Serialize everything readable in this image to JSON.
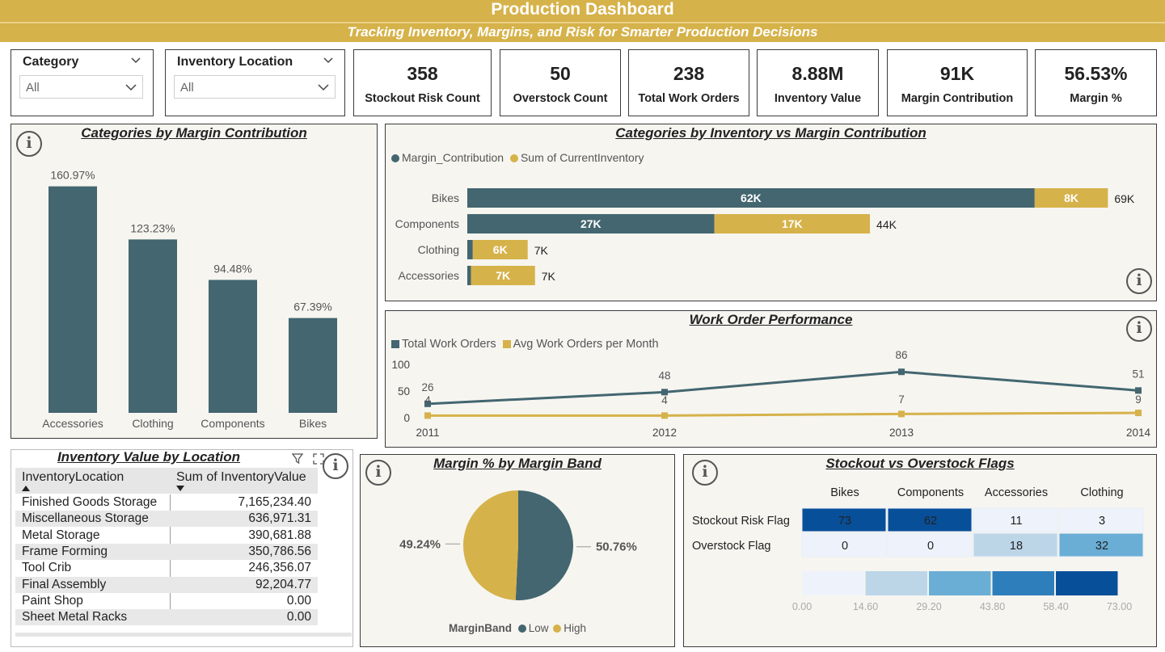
{
  "header": {
    "title": "Production Dashboard",
    "subtitle": "Tracking Inventory, Margins, and Risk for Smarter Production Decisions"
  },
  "slicers": [
    {
      "label": "Category",
      "value": "All"
    },
    {
      "label": "Inventory Location",
      "value": "All"
    }
  ],
  "kpis": [
    {
      "value": "358",
      "label": "Stockout Risk Count"
    },
    {
      "value": "50",
      "label": "Overstock Count"
    },
    {
      "value": "238",
      "label": "Total Work Orders"
    },
    {
      "value": "8.88M",
      "label": "Inventory Value"
    },
    {
      "value": "91K",
      "label": "Margin Contribution"
    },
    {
      "value": "56.53%",
      "label": "Margin %"
    }
  ],
  "colors": {
    "gold": "#d6b24a",
    "teal": "#436670",
    "card_bg": "#f6f5f0",
    "heat": [
      "#eef3fb",
      "#bcd6e8",
      "#6aaed6",
      "#2f7ebc",
      "#084f99"
    ]
  },
  "icons": {
    "info": "i",
    "filter": "filter-icon",
    "focus": "focus-mode-icon",
    "more": "more-options-icon",
    "chevron": "chevron-down-icon"
  },
  "chart_data": [
    {
      "id": "margin_contribution",
      "type": "bar",
      "title": "Categories by Margin Contribution",
      "categories": [
        "Accessories",
        "Clothing",
        "Components",
        "Bikes"
      ],
      "values": [
        160.97,
        123.23,
        94.48,
        67.39
      ],
      "value_labels": [
        "160.97%",
        "123.23%",
        "94.48%",
        "67.39%"
      ],
      "ylim": [
        0,
        180
      ]
    },
    {
      "id": "inventory_vs_margin",
      "type": "bar",
      "orientation": "horizontal-stacked",
      "title": "Categories by Inventory vs Margin Contribution",
      "categories": [
        "Bikes",
        "Components",
        "Clothing",
        "Accessories"
      ],
      "series": [
        {
          "name": "Margin_Contribution",
          "values": [
            62,
            27,
            0.6,
            0.4
          ],
          "labels": [
            "62K",
            "27K",
            "",
            ""
          ]
        },
        {
          "name": "Sum of CurrentInventory",
          "values": [
            8,
            17,
            6,
            7
          ],
          "labels": [
            "8K",
            "17K",
            "6K",
            "7K"
          ]
        }
      ],
      "totals": [
        "69K",
        "44K",
        "7K",
        "7K"
      ],
      "total_values": [
        69,
        44,
        7,
        7
      ],
      "xmax": 72
    },
    {
      "id": "work_orders",
      "type": "line",
      "title": "Work Order Performance",
      "x": [
        "2011",
        "2012",
        "2013",
        "2014"
      ],
      "series": [
        {
          "name": "Total Work Orders",
          "values": [
            26,
            48,
            86,
            51
          ],
          "labels": [
            "26",
            "48",
            "86",
            "51"
          ]
        },
        {
          "name": "Avg Work Orders per Month",
          "values": [
            4,
            4,
            7,
            9
          ],
          "labels": [
            "4",
            "4",
            "7",
            "9"
          ]
        }
      ],
      "yticks": [
        "100",
        "50",
        "0"
      ],
      "ylim": [
        0,
        100
      ]
    },
    {
      "id": "margin_band",
      "type": "pie",
      "title": "Margin % by Margin Band",
      "legend_title": "MarginBand",
      "slices": [
        {
          "name": "Low",
          "value": 50.76,
          "label": "50.76%"
        },
        {
          "name": "High",
          "value": 49.24,
          "label": "49.24%"
        }
      ]
    },
    {
      "id": "flags",
      "type": "heatmap",
      "title": "Stockout vs Overstock Flags",
      "columns": [
        "Bikes",
        "Components",
        "Accessories",
        "Clothing"
      ],
      "rows": [
        {
          "name": "Stockout Risk Flag",
          "values": [
            73,
            62,
            11,
            3
          ]
        },
        {
          "name": "Overstock Flag",
          "values": [
            0,
            0,
            18,
            32
          ]
        }
      ],
      "scale_ticks": [
        "0.00",
        "14.60",
        "29.20",
        "43.80",
        "58.40",
        "73.00"
      ],
      "scale_max": 73
    }
  ],
  "location_table": {
    "title": "Inventory Value by Location",
    "headers": [
      "InventoryLocation",
      "Sum of InventoryValue"
    ],
    "rows": [
      [
        "Finished Goods Storage",
        "7,165,234.40"
      ],
      [
        "Miscellaneous Storage",
        "636,971.31"
      ],
      [
        "Metal Storage",
        "390,681.88"
      ],
      [
        "Frame Forming",
        "350,786.56"
      ],
      [
        "Tool Crib",
        "246,356.07"
      ],
      [
        "Final Assembly",
        "92,204.77"
      ],
      [
        "Paint Shop",
        "0.00"
      ],
      [
        "Sheet Metal Racks",
        "0.00"
      ]
    ]
  }
}
